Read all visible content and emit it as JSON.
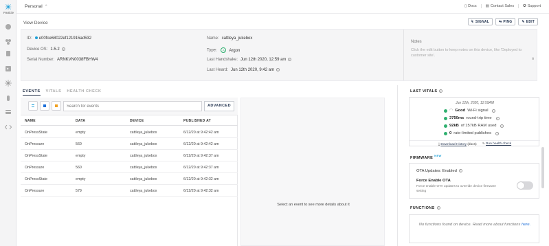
{
  "app": {
    "brand": "Particle"
  },
  "topbar": {
    "org": "Personal",
    "links": [
      {
        "label": "Docs",
        "icon": "doc-icon"
      },
      {
        "label": "Contact Sales",
        "icon": "contact-icon"
      },
      {
        "label": "Support",
        "icon": "support-icon"
      }
    ]
  },
  "header": {
    "title": "View Device",
    "actions": {
      "signal": "SIGNAL",
      "ping": "PING",
      "edit": "EDIT"
    }
  },
  "device": {
    "id_label": "ID:",
    "id": "e00fce68022ef121915ad532",
    "os_label": "Device OS:",
    "os": "1.5.2",
    "serial_label": "Serial Number:",
    "serial": "ARNKVN0038FBHW4",
    "name_label": "Name:",
    "name": "cattleya_jukebox",
    "type_label": "Type:",
    "type": "Argon",
    "handshake_label": "Last Handshake:",
    "handshake": "Jun 12th 2020, 12:59 am",
    "heard_label": "Last Heard:",
    "heard": "Jun 12th 2020, 9:42 am"
  },
  "notes": {
    "label": "Notes",
    "placeholder": "Click the edit button to keep notes on this device, like 'Deployed to customer site'."
  },
  "tabs": [
    "EVENTS",
    "VITALS",
    "HEALTH CHECK"
  ],
  "events": {
    "search_placeholder": "Search for events",
    "advanced": "ADVANCED",
    "columns": [
      "NAME",
      "DATA",
      "DEVICE",
      "PUBLISHED AT"
    ],
    "rows": [
      [
        "OnPressState",
        "empty",
        "cattleya_jukebox",
        "6/12/20 at 9:42:42 am"
      ],
      [
        "OnPressure",
        "560",
        "cattleya_jukebox",
        "6/12/20 at 9:42:42 am"
      ],
      [
        "OnPressState",
        "empty",
        "cattleya_jukebox",
        "6/12/20 at 9:42:37 am"
      ],
      [
        "OnPressure",
        "560",
        "cattleya_jukebox",
        "6/12/20 at 9:42:37 am"
      ],
      [
        "OnPressState",
        "empty",
        "cattleya_jukebox",
        "6/12/20 at 9:42:32 am"
      ],
      [
        "OnPressure",
        "579",
        "cattleya_jukebox",
        "6/12/20 at 9:42:32 am"
      ]
    ],
    "details_empty": "Select an event to see more details about it"
  },
  "vitals": {
    "heading": "LAST VITALS",
    "when": "Jun 12th, 2020, 12:59AM",
    "signal_value": "Good",
    "signal_text": "Wi-Fi signal",
    "rtt_value": "3750ms",
    "rtt_text": "round-trip time",
    "ram_value": "92kB",
    "ram_text": "of 157kB RAM used",
    "rl_value": "0",
    "rl_text": "rate-limited publishes",
    "download": "Download History",
    "docs": "(docs)",
    "run": "Run health check"
  },
  "firmware": {
    "heading": "FIRMWARE",
    "badge": "NEW",
    "ota_label": "OTA Updates:",
    "ota_value": "Enabled",
    "force_title": "Force Enable OTA",
    "force_desc": "Force enable OTA updates to override device firmware setting",
    "force_enabled": false
  },
  "functions": {
    "heading": "FUNCTIONS",
    "empty": "No functions found on device. Read more about functions",
    "link": "here."
  },
  "colors": {
    "accent": "#1d9fd8",
    "ok": "#2fb06f",
    "navy": "#1e2b44"
  }
}
